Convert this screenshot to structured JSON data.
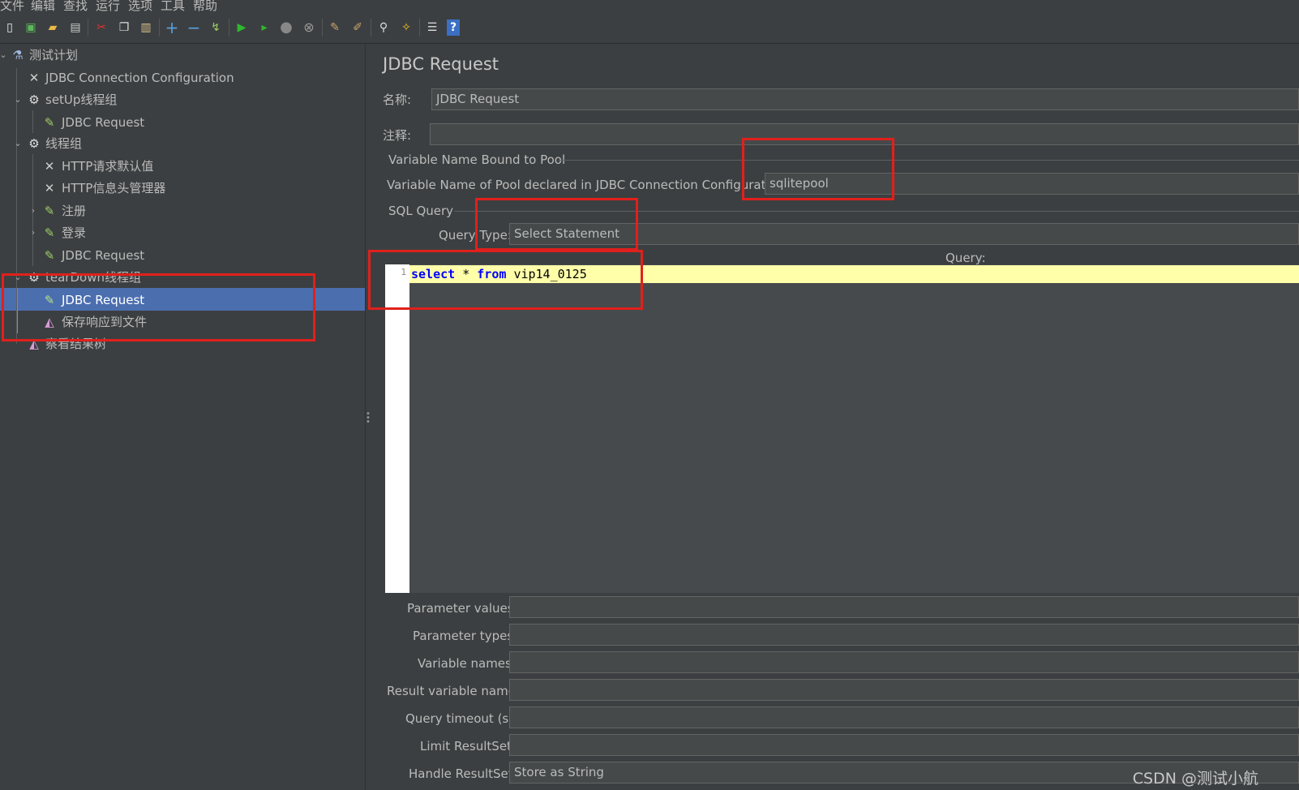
{
  "menu": [
    "文件",
    "编辑",
    "查找",
    "运行",
    "选项",
    "工具",
    "帮助"
  ],
  "toolbar_icons": [
    "new-icon",
    "templates-icon",
    "open-icon",
    "save-icon",
    "cut-icon",
    "copy-icon",
    "paste-icon",
    "expand-icon",
    "collapse-icon",
    "toggle-icon",
    "start-icon",
    "start-no-pause-icon",
    "stop-icon",
    "shutdown-icon",
    "clear-icon",
    "clear-all-icon",
    "search-icon",
    "reset-search-icon",
    "function-helper-icon",
    "help-icon"
  ],
  "tree": [
    {
      "label": "测试计划",
      "icon": "flask-icon",
      "depth": 0,
      "expanded": true
    },
    {
      "label": "JDBC Connection Configuration",
      "icon": "wrench-icon",
      "depth": 1
    },
    {
      "label": "setUp线程组",
      "icon": "gear-icon",
      "depth": 1,
      "expanded": true
    },
    {
      "label": "JDBC Request",
      "icon": "pipette-icon",
      "depth": 2
    },
    {
      "label": "线程组",
      "icon": "gear-icon",
      "depth": 1,
      "expanded": true
    },
    {
      "label": "HTTP请求默认值",
      "icon": "wrench-icon",
      "depth": 2
    },
    {
      "label": "HTTP信息头管理器",
      "icon": "wrench-icon",
      "depth": 2
    },
    {
      "label": "注册",
      "icon": "pipette-icon",
      "depth": 2,
      "expanded": false
    },
    {
      "label": "登录",
      "icon": "pipette-icon",
      "depth": 2,
      "expanded": false
    },
    {
      "label": "JDBC Request",
      "icon": "pipette-icon",
      "depth": 2
    },
    {
      "label": "tearDown线程组",
      "icon": "gear-icon",
      "depth": 1,
      "expanded": true
    },
    {
      "label": "JDBC Request",
      "icon": "pipette-icon",
      "depth": 2,
      "selected": true
    },
    {
      "label": "保存响应到文件",
      "icon": "chart-icon",
      "depth": 2
    },
    {
      "label": "察看结果树",
      "icon": "chart-icon",
      "depth": 1
    }
  ],
  "panel": {
    "title": "JDBC Request",
    "name_label": "名称:",
    "name_value": "JDBC Request",
    "comment_label": "注释:",
    "comment_value": "",
    "pool_group": "Variable Name Bound to Pool",
    "pool_label": "Variable Name of Pool declared in JDBC Connection Configurat on:",
    "pool_value": "sqlitepool",
    "sql_group": "SQL Query",
    "query_type_label": "Query Type:",
    "query_type_value": "Select Statement",
    "query_label": "Query:",
    "line_number": "1",
    "code": {
      "kw1": "select",
      "star": "*",
      "kw2": "from",
      "table": "vip14_0125"
    },
    "params": [
      {
        "label": "Parameter values:",
        "value": ""
      },
      {
        "label": "Parameter types:",
        "value": ""
      },
      {
        "label": "Variable names:",
        "value": ""
      },
      {
        "label": "Result variable name:",
        "value": ""
      },
      {
        "label": "Query timeout (s):",
        "value": ""
      },
      {
        "label": "Limit ResultSet:",
        "value": ""
      },
      {
        "label": "Handle ResultSet:",
        "value": "Store as String"
      }
    ]
  },
  "watermark": "CSDN @测试小航",
  "colors": {
    "selection": "#4b6eaf",
    "highlight_box": "#e0201c",
    "current_line": "#ffffaa",
    "keyword": "#0000ff"
  }
}
